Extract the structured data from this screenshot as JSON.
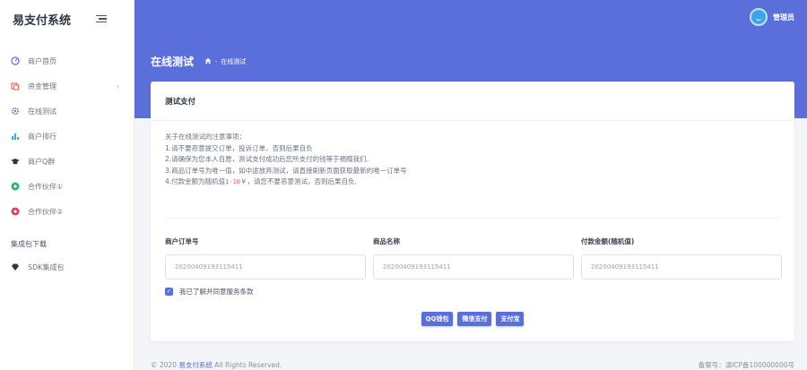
{
  "app": {
    "title": "易支付系统"
  },
  "sidebar": {
    "items": [
      {
        "label": "商户首页",
        "icon": "dashboard-icon"
      },
      {
        "label": "资金管理",
        "icon": "wallet-icon",
        "has_children": true
      },
      {
        "label": "在线测试",
        "icon": "gear-icon"
      },
      {
        "label": "商户排行",
        "icon": "bar-chart-icon"
      },
      {
        "label": "商户Q群",
        "icon": "graduation-cap-icon"
      },
      {
        "label": "合作伙伴①",
        "icon": "partner-icon-1"
      },
      {
        "label": "合作伙伴②",
        "icon": "partner-icon-2"
      }
    ],
    "section_label": "集成包下载",
    "section_items": [
      {
        "label": "SDK集成包",
        "icon": "diamond-icon"
      }
    ]
  },
  "header": {
    "user_name": "管理员",
    "page_title": "在线测试",
    "breadcrumb": "在线测试"
  },
  "card": {
    "title": "测试支付",
    "notes_heading": "关于在线测试的注意事项：",
    "notes": [
      "1.请不要恶意提交订单，投诉订单，否则后果自负",
      "2.请确保为您本人自愿，测试支付成功后您所支付的钱等于捐赠我们.",
      "3.商品订单号为唯一值，如中途放弃测试，请直接刷新页面获取最新的唯一订单号"
    ],
    "note4_prefix": "4.付款金额为随机值",
    "note4_highlight": "1-10",
    "note4_suffix": "￥，请您不要恶意测试，否则后果自负.",
    "fields": [
      {
        "label": "商户订单号",
        "value": "20200409193115411"
      },
      {
        "label": "商品名称",
        "value": "20200409193115411"
      },
      {
        "label": "付款金额(随机值)",
        "value": "20200409193115411"
      }
    ],
    "agree_label": "我已了解并同意服务条款",
    "agree_checked": true,
    "buttons": {
      "qq": "QQ钱包",
      "wechat": "微信支付",
      "alipay": "支付宝"
    }
  },
  "footer": {
    "copyright_prefix": "© 2020",
    "brand": "易支付系统",
    "copyright_suffix": "All Rights Reserved.",
    "icp": "备案号：滇ICP备100000000号"
  },
  "colors": {
    "accent": "#5b6fdb",
    "highlight": "#e4577a"
  }
}
